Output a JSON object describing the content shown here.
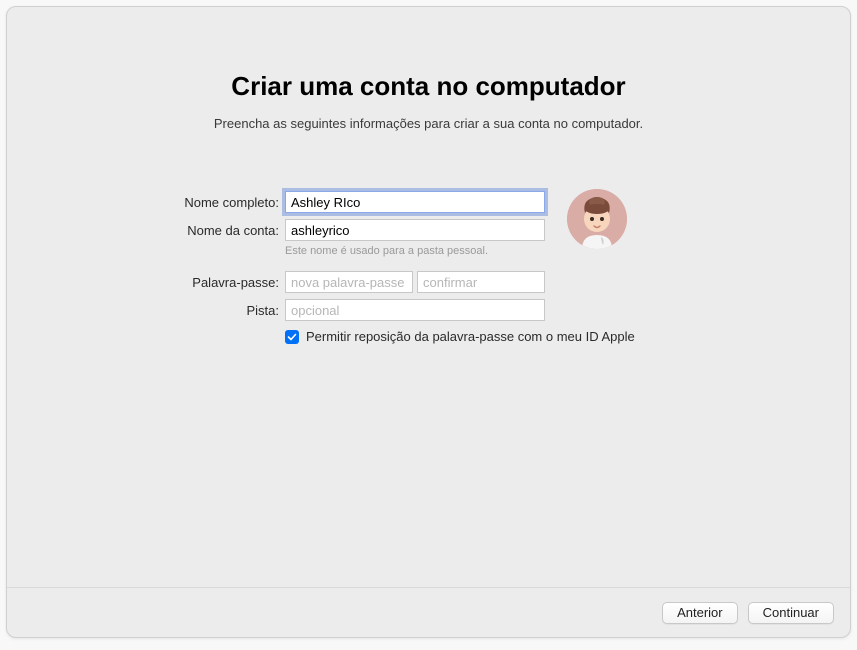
{
  "header": {
    "title": "Criar uma conta no computador",
    "subtitle": "Preencha as seguintes informações para criar a sua conta no computador."
  },
  "form": {
    "full_name": {
      "label": "Nome completo:",
      "value": "Ashley RIco"
    },
    "account_name": {
      "label": "Nome da conta:",
      "value": "ashleyrico",
      "help": "Este nome é usado para a pasta pessoal."
    },
    "password": {
      "label": "Palavra-passe:",
      "new_placeholder": "nova palavra-passe",
      "confirm_placeholder": "confirmar"
    },
    "hint": {
      "label": "Pista:",
      "placeholder": "opcional"
    },
    "allow_reset": {
      "checked": true,
      "label": "Permitir reposição da palavra-passe com o meu ID Apple"
    }
  },
  "footer": {
    "back": "Anterior",
    "continue": "Continuar"
  }
}
